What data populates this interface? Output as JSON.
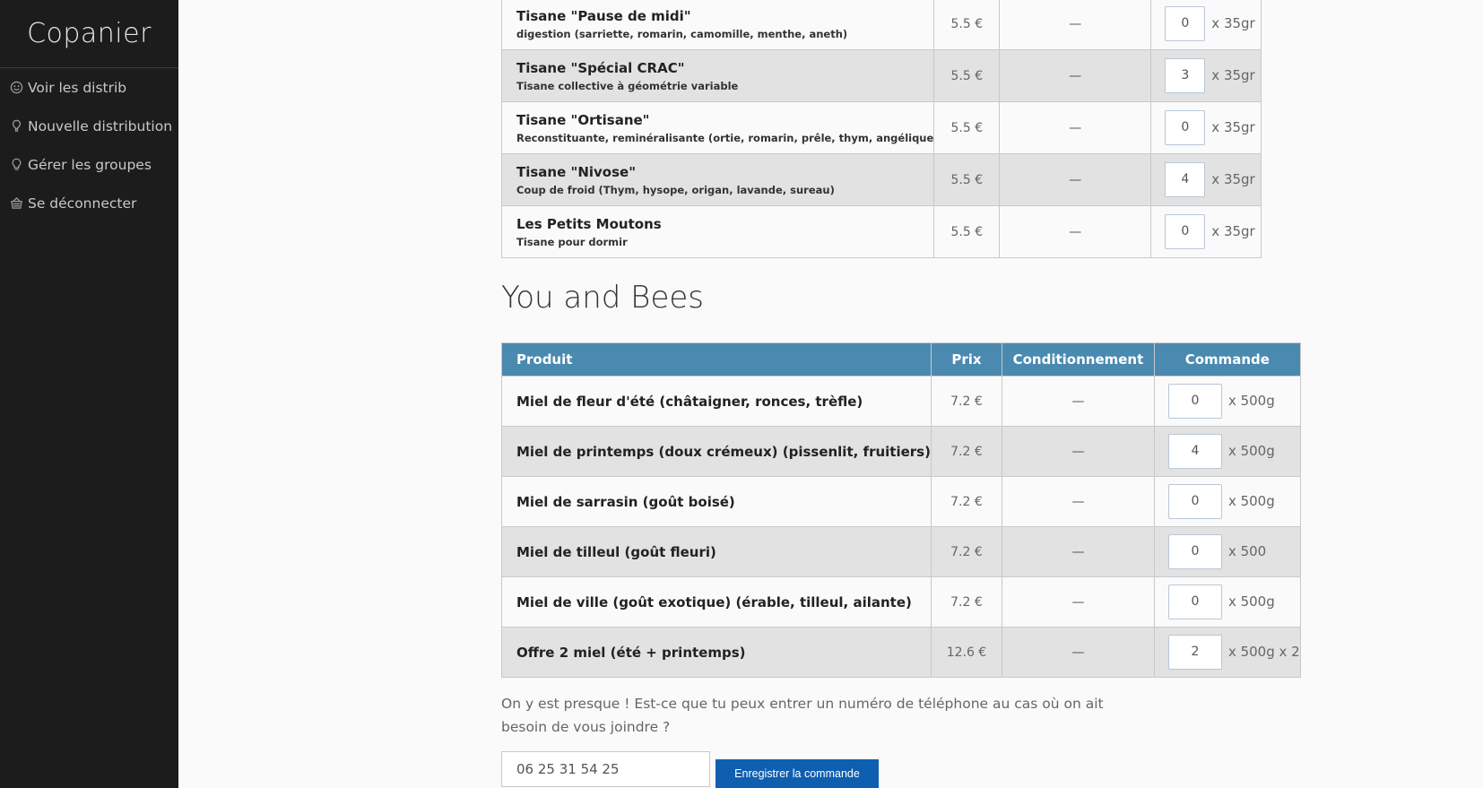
{
  "app": {
    "brand": "Copanier"
  },
  "sidebar": {
    "items": [
      {
        "label": "Voir les distrib",
        "icon": "smiley-icon"
      },
      {
        "label": "Nouvelle distribution",
        "icon": "balloon-icon"
      },
      {
        "label": "Gérer les groupes",
        "icon": "lightbulb-icon"
      },
      {
        "label": "Se déconnecter",
        "icon": "basket-icon"
      }
    ]
  },
  "supplier1": {
    "rows": [
      {
        "name": "Tisane \"Pause de midi\"",
        "desc": "digestion (sarriette, romarin, camomille, menthe, aneth)",
        "price": "5.5 €",
        "cond": "—",
        "qty": "0",
        "unit": "x 35gr"
      },
      {
        "name": "Tisane \"Spécial CRAC\"",
        "desc": "Tisane collective à géométrie variable",
        "price": "5.5 €",
        "cond": "—",
        "qty": "3",
        "unit": "x 35gr"
      },
      {
        "name": "Tisane \"Ortisane\"",
        "desc": "Reconstituante, reminéralisante (ortie, romarin, prêle, thym, angélique",
        "price": "5.5 €",
        "cond": "—",
        "qty": "0",
        "unit": "x 35gr"
      },
      {
        "name": "Tisane \"Nivose\"",
        "desc": "Coup de froid (Thym, hysope, origan, lavande, sureau)",
        "price": "5.5 €",
        "cond": "—",
        "qty": "4",
        "unit": "x 35gr"
      },
      {
        "name": "Les Petits Moutons",
        "desc": "Tisane pour dormir",
        "price": "5.5 €",
        "cond": "—",
        "qty": "0",
        "unit": "x 35gr"
      }
    ]
  },
  "supplier2": {
    "title": "You and Bees",
    "headers": {
      "product": "Produit",
      "price": "Prix",
      "cond": "Conditionnement",
      "order": "Commande"
    },
    "rows": [
      {
        "name": "Miel de fleur d'été (châtaigner, ronces, trèfle)",
        "price": "7.2 €",
        "cond": "—",
        "qty": "0",
        "unit": "x 500g"
      },
      {
        "name": "Miel de printemps (doux crémeux) (pissenlit, fruitiers)",
        "price": "7.2 €",
        "cond": "—",
        "qty": "4",
        "unit": "x 500g"
      },
      {
        "name": "Miel de sarrasin (goût boisé)",
        "price": "7.2 €",
        "cond": "—",
        "qty": "0",
        "unit": "x 500g"
      },
      {
        "name": "Miel de tilleul (goût fleuri)",
        "price": "7.2 €",
        "cond": "—",
        "qty": "0",
        "unit": "x 500"
      },
      {
        "name": "Miel de ville (goût exotique) (érable, tilleul, ailante)",
        "price": "7.2 €",
        "cond": "—",
        "qty": "0",
        "unit": "x 500g"
      },
      {
        "name": "Offre 2 miel (été + printemps)",
        "price": "12.6 €",
        "cond": "—",
        "qty": "2",
        "unit": "x 500g x 2"
      }
    ]
  },
  "footer": {
    "prompt": "On y est presque ! Est-ce que tu peux entrer un numéro de téléphone au cas où on ait besoin de vous joindre ?",
    "phone": "06 25 31 54 25",
    "submit_label": "Enregistrer la commande"
  }
}
